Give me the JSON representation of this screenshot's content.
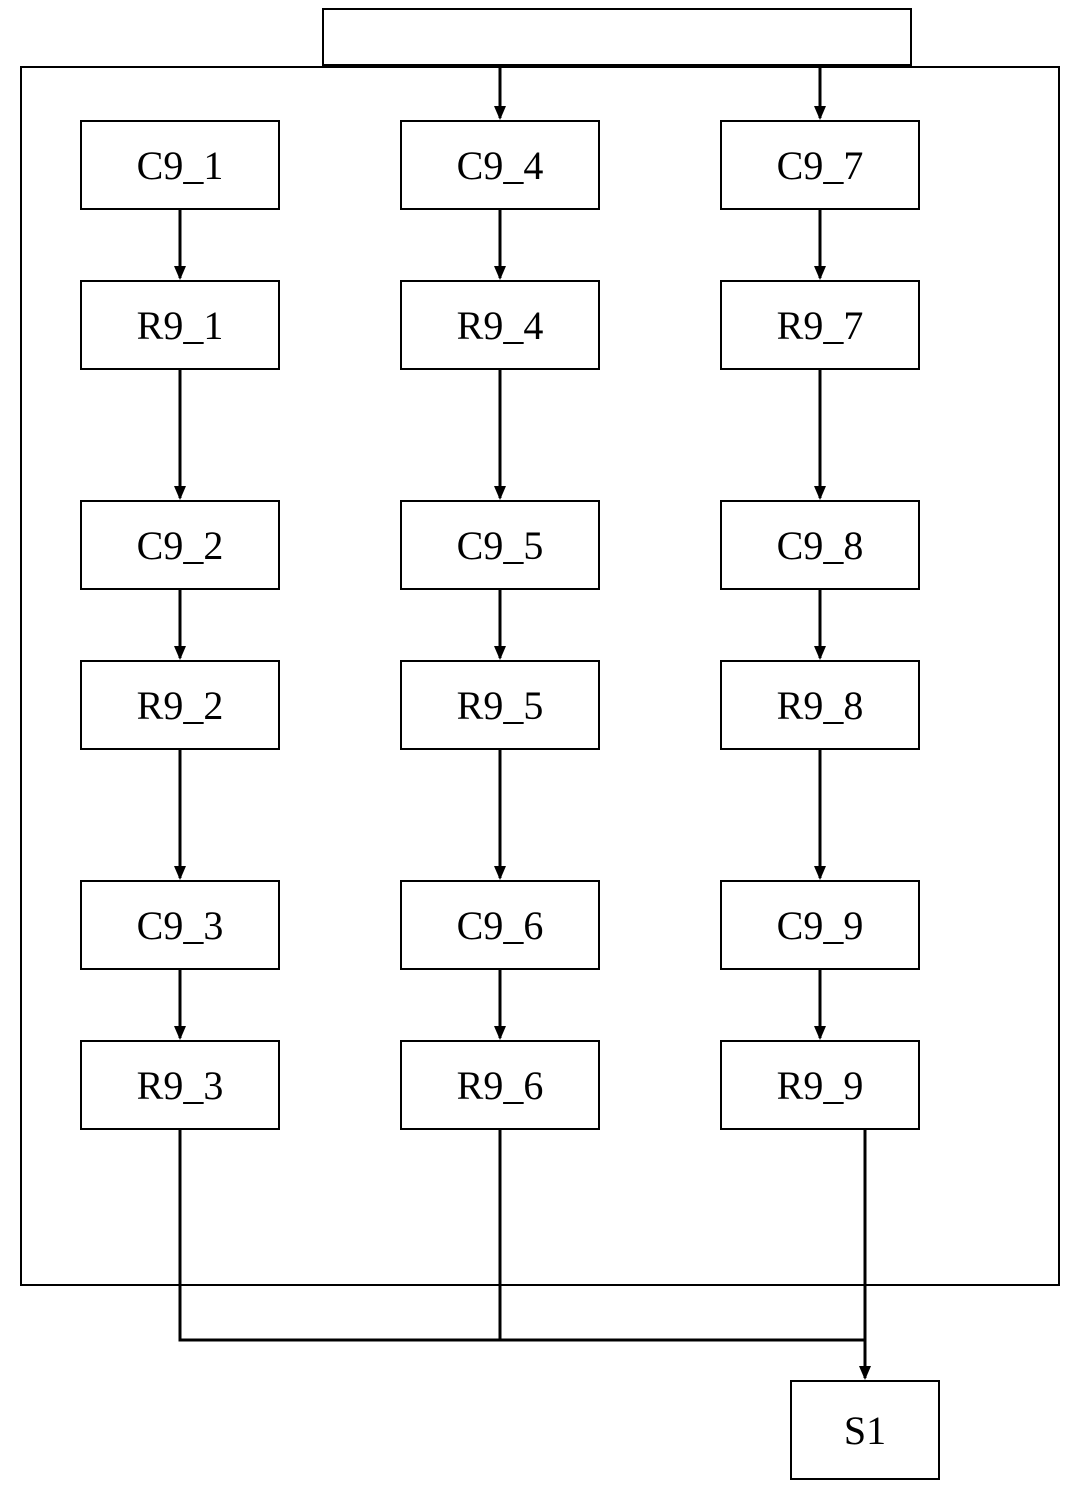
{
  "chart_data": {
    "type": "flowchart",
    "title": "",
    "columns": [
      {
        "name": "col1",
        "nodes": [
          "C9_1",
          "R9_1",
          "C9_2",
          "R9_2",
          "C9_3",
          "R9_3"
        ]
      },
      {
        "name": "col2",
        "nodes": [
          "C9_4",
          "R9_4",
          "C9_5",
          "R9_5",
          "C9_6",
          "R9_6"
        ]
      },
      {
        "name": "col3",
        "nodes": [
          "C9_7",
          "R9_7",
          "C9_8",
          "R9_8",
          "C9_9",
          "R9_9"
        ]
      }
    ],
    "sink": "S1",
    "edges_within_columns": [
      [
        "C9_1",
        "R9_1"
      ],
      [
        "R9_1",
        "C9_2"
      ],
      [
        "C9_2",
        "R9_2"
      ],
      [
        "R9_2",
        "C9_3"
      ],
      [
        "C9_3",
        "R9_3"
      ],
      [
        "C9_4",
        "R9_4"
      ],
      [
        "R9_4",
        "C9_5"
      ],
      [
        "C9_5",
        "R9_5"
      ],
      [
        "R9_5",
        "C9_6"
      ],
      [
        "C9_6",
        "R9_6"
      ],
      [
        "C9_7",
        "R9_7"
      ],
      [
        "R9_7",
        "C9_8"
      ],
      [
        "C9_8",
        "R9_8"
      ],
      [
        "R9_8",
        "C9_9"
      ],
      [
        "C9_9",
        "R9_9"
      ]
    ],
    "top_fanout": {
      "from": "top-source",
      "to": [
        "C9_1",
        "C9_4",
        "C9_7"
      ],
      "note": "three branches enter the outer container from above into each column head"
    },
    "bottom_fanin": {
      "from": [
        "R9_3",
        "R9_6",
        "R9_9"
      ],
      "to": "S1",
      "note": "all three column tails converge into S1"
    }
  },
  "labels": {
    "col1": {
      "n0": "C9_1",
      "n1": "R9_1",
      "n2": "C9_2",
      "n3": "R9_2",
      "n4": "C9_3",
      "n5": "R9_3"
    },
    "col2": {
      "n0": "C9_4",
      "n1": "R9_4",
      "n2": "C9_5",
      "n3": "R9_5",
      "n4": "C9_6",
      "n5": "R9_6"
    },
    "col3": {
      "n0": "C9_7",
      "n1": "R9_7",
      "n2": "C9_8",
      "n3": "R9_8",
      "n4": "C9_9",
      "n5": "R9_9"
    },
    "sink": "S1"
  }
}
